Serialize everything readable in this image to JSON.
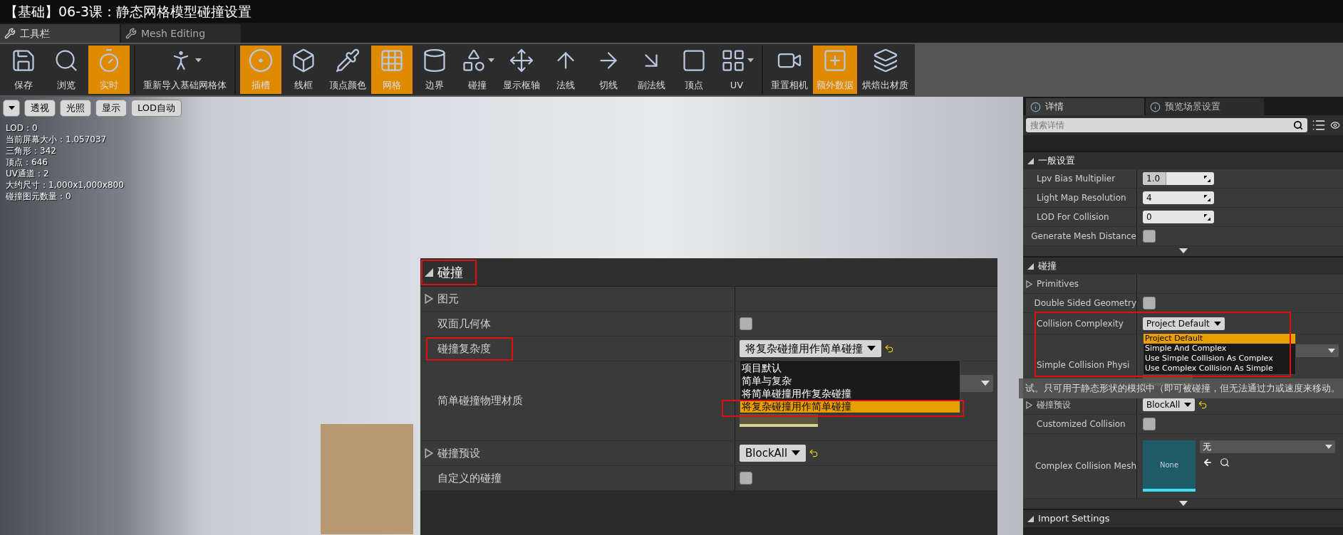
{
  "video_title": "【基础】06-3课：静态网格模型碰撞设置",
  "editor_tabs": [
    {
      "label": "工具栏",
      "selected": true
    },
    {
      "label": "Mesh Editing",
      "selected": false
    }
  ],
  "toolbar_groups": [
    [
      {
        "label": "保存",
        "active": false,
        "dropdown": false
      },
      {
        "label": "浏览",
        "active": false,
        "dropdown": false
      },
      {
        "label": "实时",
        "active": true,
        "dropdown": false
      }
    ],
    [
      {
        "label": "重新导入基础网格体",
        "active": false,
        "dropdown": true
      }
    ],
    [
      {
        "label": "插槽",
        "active": true,
        "dropdown": false
      },
      {
        "label": "线框",
        "active": false,
        "dropdown": false
      },
      {
        "label": "顶点颜色",
        "active": false,
        "dropdown": false
      },
      {
        "label": "网格",
        "active": true,
        "dropdown": false
      },
      {
        "label": "边界",
        "active": false,
        "dropdown": false
      },
      {
        "label": "碰撞",
        "active": false,
        "dropdown": true
      },
      {
        "label": "显示枢轴",
        "active": false,
        "dropdown": false
      },
      {
        "label": "法线",
        "active": false,
        "dropdown": false
      },
      {
        "label": "切线",
        "active": false,
        "dropdown": false
      },
      {
        "label": "副法线",
        "active": false,
        "dropdown": false
      },
      {
        "label": "顶点",
        "active": false,
        "dropdown": false
      },
      {
        "label": "UV",
        "active": false,
        "dropdown": true
      }
    ],
    [
      {
        "label": "重置相机",
        "active": false,
        "dropdown": false
      },
      {
        "label": "额外数据",
        "active": true,
        "dropdown": false
      },
      {
        "label": "烘焙出材质",
        "active": false,
        "dropdown": false
      }
    ]
  ],
  "viewport": {
    "buttons": [
      {
        "label": "透视"
      },
      {
        "label": "光照"
      },
      {
        "label": "显示"
      },
      {
        "label": "LOD自动"
      }
    ],
    "stats": [
      "LOD：0",
      "当前屏幕大小：1.057037",
      "三角形：342",
      "顶点：646",
      "UV通道：2",
      "大约尺寸：1,000x1,000x800",
      "碰撞图元数量：0"
    ]
  },
  "zoomed_panel": {
    "section": "碰撞",
    "rows": [
      {
        "kind": "group",
        "label": "图元"
      },
      {
        "kind": "checkbox",
        "label": "双面几何体",
        "checked": false
      },
      {
        "kind": "dropdown",
        "label": "碰撞复杂度",
        "value": "将复杂碰撞用作简单碰撞",
        "reset": true,
        "highlighted": true,
        "options": [
          {
            "label": "项目默认",
            "selected": false
          },
          {
            "label": "简单与复杂",
            "selected": false
          },
          {
            "label": "将简单碰撞用作复杂碰撞",
            "selected": false
          },
          {
            "label": "将复杂碰撞用作简单碰撞",
            "selected": true
          }
        ]
      },
      {
        "kind": "material",
        "label": "简单碰撞物理材质"
      },
      {
        "kind": "group_dropdown",
        "label": "碰撞预设",
        "value": "BlockAll",
        "reset": true
      },
      {
        "kind": "checkbox",
        "label": "自定义的碰撞",
        "checked": false
      }
    ]
  },
  "details": {
    "tabs": [
      {
        "label": "详情",
        "selected": true
      },
      {
        "label": "预览场景设置",
        "selected": false
      }
    ],
    "search": {
      "placeholder": "搜索详情"
    },
    "sections": [
      {
        "title": "一般设置",
        "rows": [
          {
            "kind": "number",
            "label": "Lpv Bias Multiplier",
            "value": "1.0",
            "level": 0.33
          },
          {
            "kind": "number",
            "label": "Light Map Resolution",
            "value": "4"
          },
          {
            "kind": "number",
            "label": "LOD For Collision",
            "value": "0"
          },
          {
            "kind": "checkbox",
            "label": "Generate Mesh Distance",
            "checked": false
          }
        ],
        "more": true
      },
      {
        "title": "碰撞",
        "rows": [
          {
            "kind": "group",
            "label": "Primitives"
          },
          {
            "kind": "checkbox",
            "label": "Double Sided Geometry",
            "checked": false
          },
          {
            "kind": "dropdown",
            "label": "Collision Complexity",
            "value": "Project Default",
            "reset": false,
            "highlighted": true,
            "options": [
              {
                "label": "Project Default",
                "selected": true
              },
              {
                "label": "Simple And Complex",
                "selected": false
              },
              {
                "label": "Use Simple Collision As Complex",
                "selected": false
              },
              {
                "label": "Use Complex Collision As Simple",
                "selected": false
              }
            ]
          },
          {
            "kind": "material",
            "label": "Simple Collision Physi"
          },
          {
            "kind": "group_dropdown",
            "label": "碰撞预设",
            "value": "BlockAll",
            "reset": true
          },
          {
            "kind": "checkbox",
            "label": "Customized Collision",
            "checked": false
          },
          {
            "kind": "asset",
            "label": "Complex Collision Mesh",
            "thumbnail": "None",
            "value": "无"
          }
        ],
        "more": true
      },
      {
        "title": "Import Settings",
        "more": false
      }
    ],
    "tooltip": "试。只可用于静态形状的模拟中（即可被碰撞，但无法通过力或速度来移动。"
  }
}
